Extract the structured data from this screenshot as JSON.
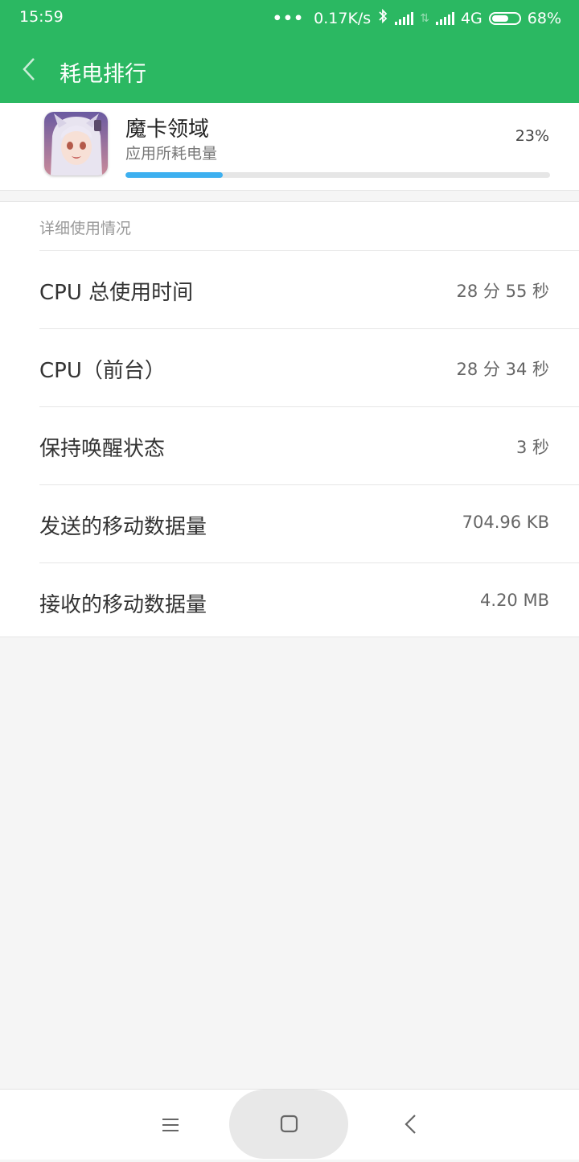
{
  "status_bar": {
    "time": "15:59",
    "dots": "•••",
    "net_speed": "0.17K/s",
    "network_type": "4G",
    "battery_pct": "68%",
    "battery_level": 0.68
  },
  "header": {
    "title": "耗电排行",
    "color": "#2bb862"
  },
  "app": {
    "name": "魔卡领域",
    "subtitle": "应用所耗电量",
    "percent_label": "23%",
    "usage_fraction": 0.23,
    "bar_color": "#3db0f0"
  },
  "details": {
    "section_title": "详细使用情况",
    "rows": [
      {
        "label": "CPU 总使用时间",
        "value": "28 分 55 秒"
      },
      {
        "label": "CPU（前台）",
        "value": "28 分 34 秒"
      },
      {
        "label": "保持唤醒状态",
        "value": "3 秒"
      },
      {
        "label": "发送的移动数据量",
        "value": "704.96 KB"
      },
      {
        "label": "接收的移动数据量",
        "value": "4.20 MB"
      }
    ]
  },
  "nav": {
    "icons": [
      "menu-icon",
      "home-icon",
      "back-icon"
    ]
  }
}
